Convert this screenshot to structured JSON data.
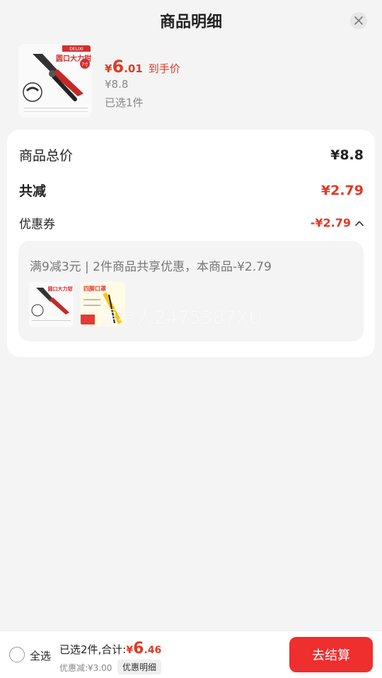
{
  "header": {
    "title": "商品明细"
  },
  "icons": {
    "close": "close-icon",
    "chevron": "chevron-up-icon",
    "radio": "radio-unchecked-icon"
  },
  "product": {
    "image_label": "圆口大力钳",
    "image_brand": "DELIXI",
    "image_badge": "7寸",
    "price_yen": "¥",
    "price_int": "6",
    "price_dec": ".01",
    "price_tag": "到手价",
    "original_price": "¥8.8",
    "selected": "已选1件"
  },
  "summary_card": {
    "total_label": "商品总价",
    "total_value": "¥8.8",
    "reduce_label": "共减",
    "reduce_value": "¥2.79",
    "coupon_label": "优惠券",
    "coupon_value": "-¥2.79",
    "coupon_desc": "满9减3元 | 2件商品共享优惠，本商品-¥2.79",
    "item2_label": "四脚口罩"
  },
  "watermark": "要星人2475387XU",
  "bottom": {
    "select_all": "全选",
    "summary_prefix": "已选2件,合计:",
    "sum_yen": "¥",
    "sum_int": "6",
    "sum_dec": ".46",
    "discount_note": "优惠减:¥3.00",
    "detail_button": "优惠明细",
    "checkout_button": "去结算"
  },
  "colors": {
    "accent": "#e03a24",
    "checkout": "#ef2e2e",
    "background": "#f4f4f4"
  }
}
